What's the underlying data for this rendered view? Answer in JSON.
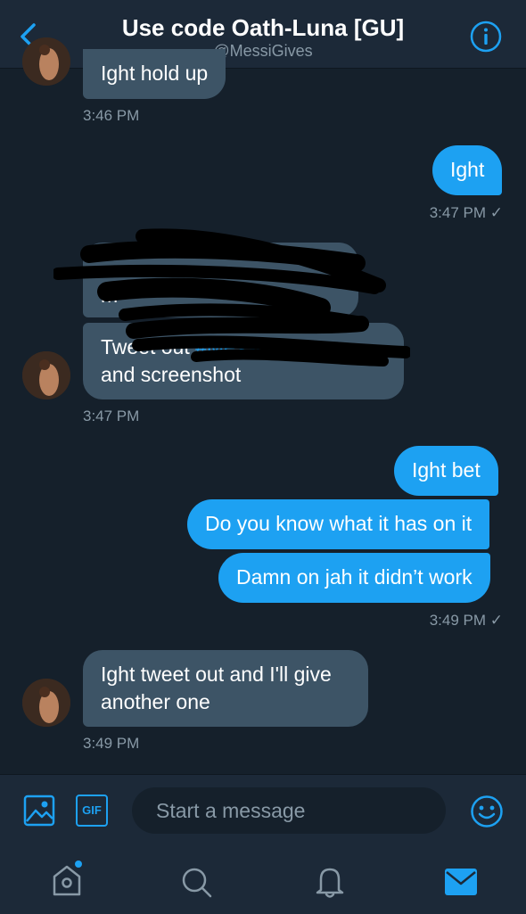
{
  "header": {
    "title": "Use code Oath-Luna [GU]",
    "handle": "@MessiGives",
    "back_icon": "chevron-left-icon",
    "info_icon": "info-icon"
  },
  "conversation": {
    "messages": [
      {
        "side": "received",
        "text": "Ight hold up"
      },
      {
        "side": "received_timestamp",
        "time": "3:46 PM"
      },
      {
        "side": "sent",
        "text": "Ight"
      },
      {
        "side": "sent_timestamp",
        "time": "3:47 PM ✓"
      },
      {
        "side": "received",
        "text_line1": "Tweet out",
        "link_text": "#Messi",
        "text_line2": "and screenshot",
        "redacted": true
      },
      {
        "side": "received_timestamp",
        "time": "3:47 PM"
      },
      {
        "side": "sent",
        "text": "Ight bet"
      },
      {
        "side": "sent",
        "text": "Do you know what it has on it"
      },
      {
        "side": "sent",
        "text": "Damn on jah it didn’t work"
      },
      {
        "side": "sent_timestamp",
        "time": "3:49 PM ✓"
      },
      {
        "side": "received",
        "text_line1": "Ight tweet out and I'll give",
        "text_line2": "another one"
      },
      {
        "side": "received_timestamp",
        "time": "3:49 PM"
      }
    ]
  },
  "composer": {
    "placeholder": "Start a message",
    "gif_label": "GIF",
    "image_icon": "image-icon",
    "emoji_icon": "emoji-icon"
  },
  "tabbar": {
    "items": [
      "home-icon",
      "search-icon",
      "notifications-icon",
      "messages-icon"
    ],
    "active": "messages-icon"
  },
  "colors": {
    "background": "#15202b",
    "header": "#1c2938",
    "accent": "#1da1f2",
    "received_bubble": "#3d5466",
    "muted_text": "#8899a6"
  }
}
